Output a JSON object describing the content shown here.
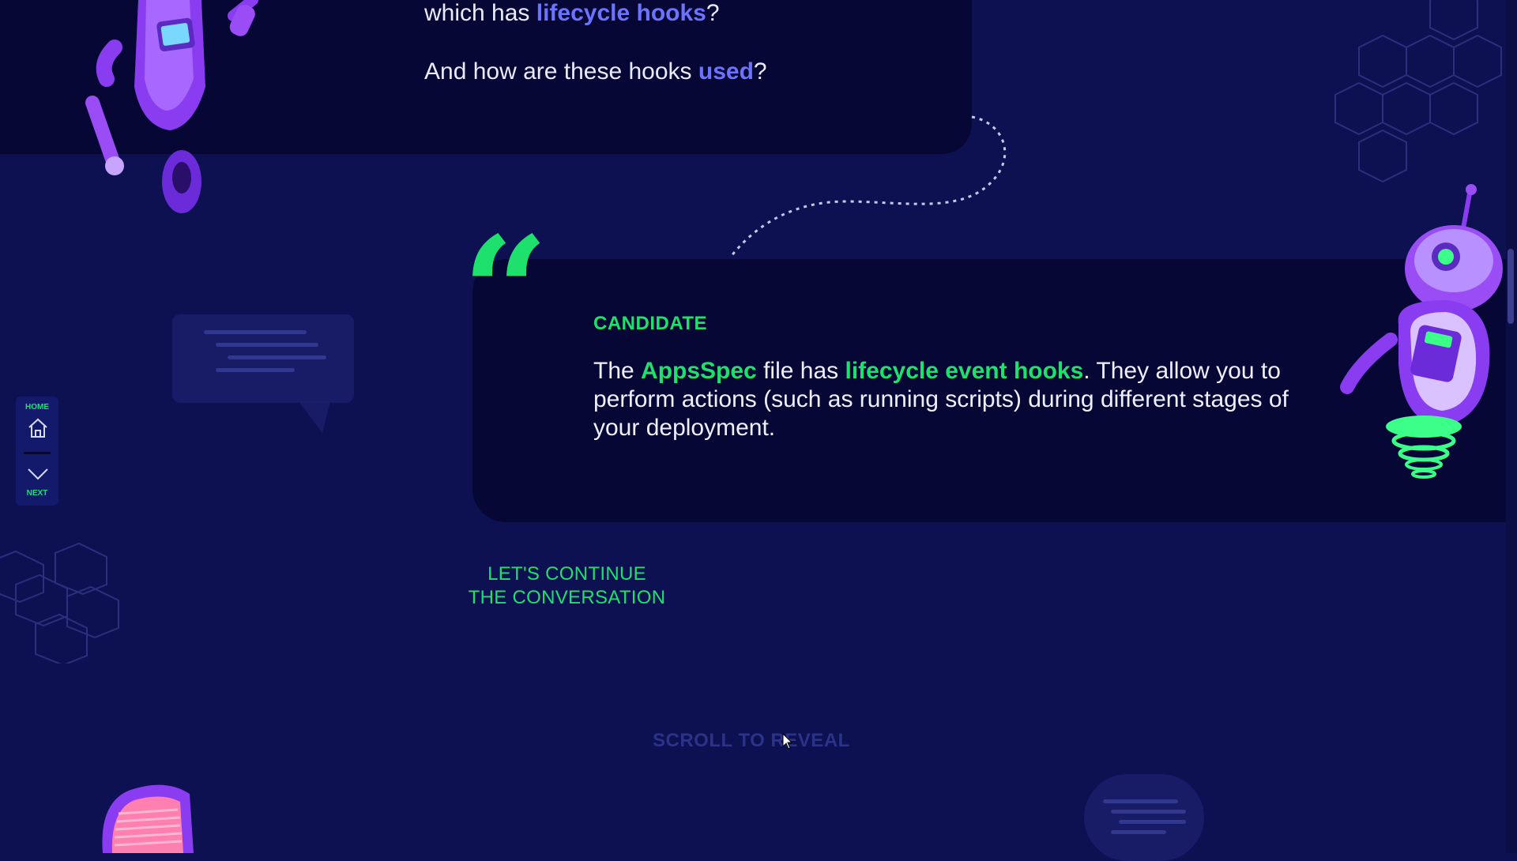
{
  "question": {
    "line1_prefix": "which has ",
    "line1_highlight": "lifecycle hooks",
    "line1_suffix": "?",
    "line2_prefix": "And how are these hooks ",
    "line2_highlight": "used",
    "line2_suffix": "?"
  },
  "answer": {
    "speaker": "CANDIDATE",
    "part1": "The ",
    "highlight1": "AppsSpec",
    "part2": " file has ",
    "highlight2": "lifecycle event hooks",
    "part3": ". They allow you to perform actions (such as running scripts) during different stages of your deployment."
  },
  "continue": {
    "line1": "LET'S CONTINUE",
    "line2": "THE CONVERSATION"
  },
  "scroll_hint": "SCROLL TO REVEAL",
  "nav": {
    "home_label": "HOME",
    "next_label": "NEXT"
  },
  "colors": {
    "background": "#0d1152",
    "card": "#070735",
    "accent_green": "#1ee06d",
    "accent_blue": "#6b73ff",
    "robot_purple": "#8a3df0"
  },
  "icons": [
    "home-icon",
    "chevron-down-icon",
    "quote-icon"
  ]
}
